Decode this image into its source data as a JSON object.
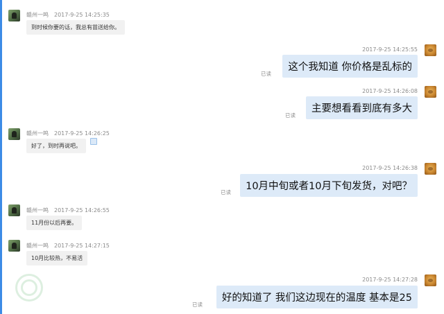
{
  "messages": [
    {
      "side": "left",
      "nick": "赣州一鸣",
      "time": "2017-9-25 14:25:35",
      "text": "到时候你要的话，我总有苗送给你。"
    },
    {
      "side": "right",
      "time": "2017-9-25 14:25:55",
      "text": "这个我知道 你价格是乱标的",
      "read": "已读"
    },
    {
      "side": "right",
      "time": "2017-9-25 14:26:08",
      "text": "主要想看看到底有多大",
      "read": "已读"
    },
    {
      "side": "left",
      "nick": "赣州一鸣",
      "time": "2017-9-25 14:26:25",
      "text": "好了，到时再说吧。"
    },
    {
      "side": "right",
      "time": "2017-9-25 14:26:38",
      "text": "10月中旬或者10月下旬发货，对吧？",
      "read": "已读"
    },
    {
      "side": "left",
      "nick": "赣州一鸣",
      "time": "2017-9-25 14:26:55",
      "text": "11月份以后再要。"
    },
    {
      "side": "left",
      "nick": "赣州一鸣",
      "time": "2017-9-25 14:27:15",
      "text": "10月比较热，不易活"
    },
    {
      "side": "right",
      "time": "2017-9-25 14:27:28",
      "text": "好的知道了 我们这边现在的温度 基本是25",
      "read": "已读"
    }
  ]
}
